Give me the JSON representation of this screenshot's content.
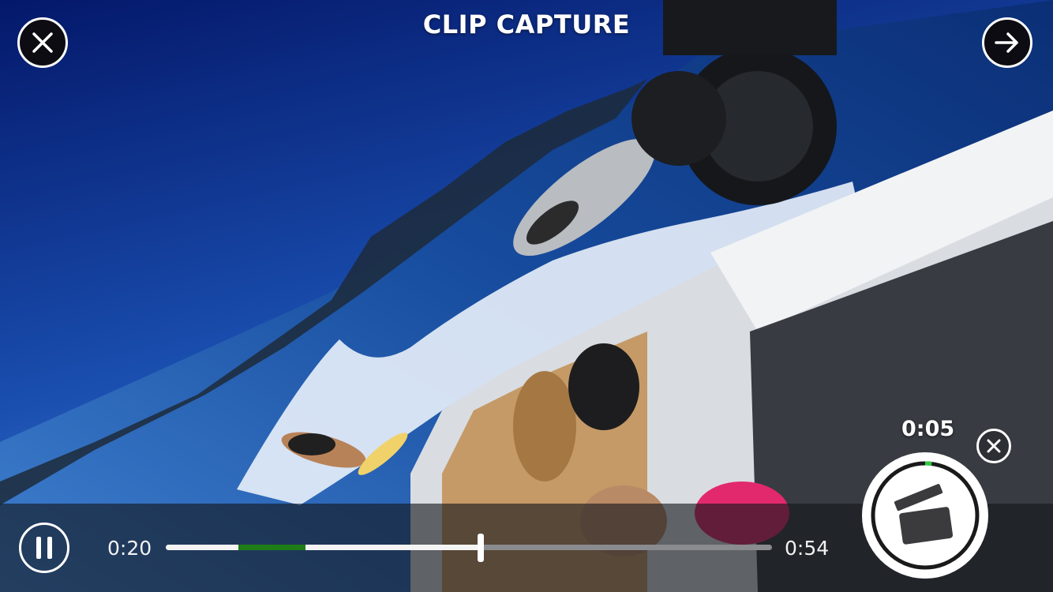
{
  "header": {
    "title": "CLIP CAPTURE",
    "close_icon": "close-icon",
    "next_icon": "arrow-right-icon"
  },
  "player": {
    "pause_icon": "pause-icon",
    "current_time": "0:20",
    "total_time": "0:54",
    "progress_fraction": 0.52,
    "clip_segment_start_fraction": 0.12,
    "clip_segment_end_fraction": 0.23
  },
  "clip": {
    "elapsed": "0:05",
    "elapsed_fraction": 0.02,
    "cancel_icon": "close-icon",
    "capture_icon": "clapperboard-icon"
  },
  "colors": {
    "accent_green": "#1e7d16",
    "ring_green": "#2ecc40",
    "sky": "#0a2a6e",
    "water": "#1c56a8"
  }
}
